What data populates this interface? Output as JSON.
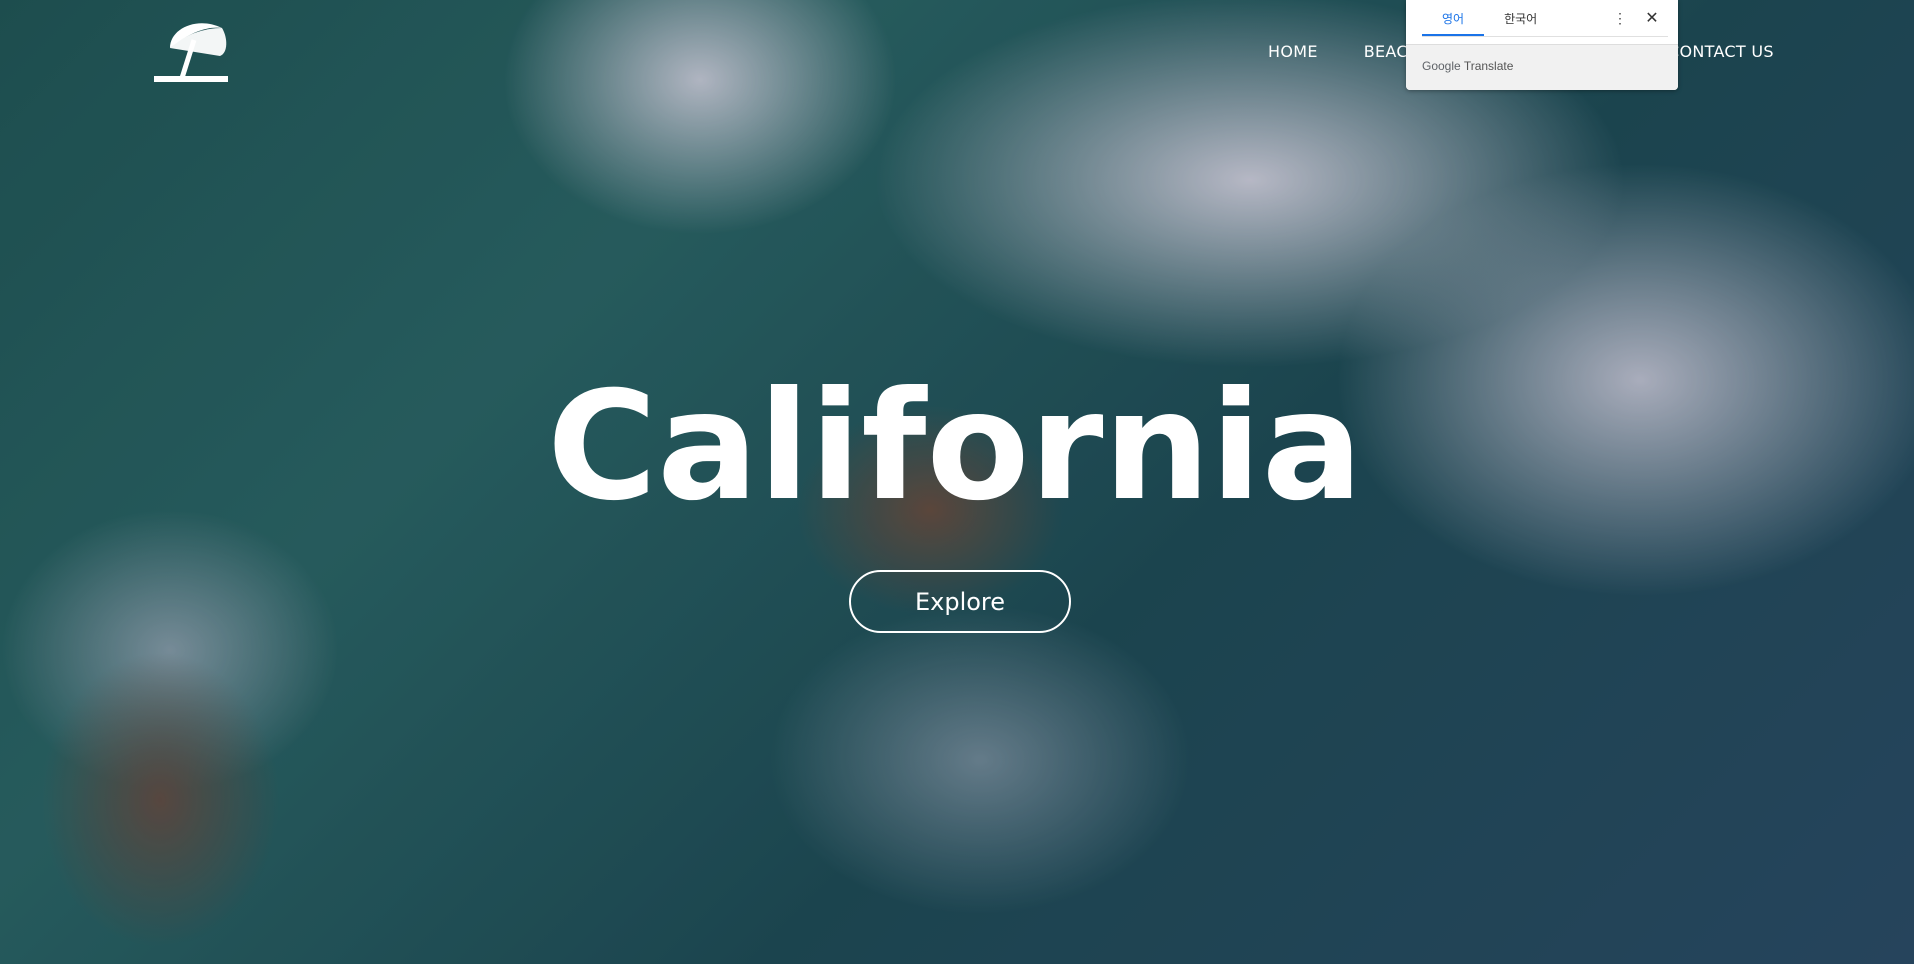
{
  "nav": {
    "items": [
      {
        "label": "HOME"
      },
      {
        "label": "BEACH"
      },
      {
        "label": "CONTACT US"
      }
    ]
  },
  "hero": {
    "title": "California",
    "cta_label": "Explore"
  },
  "translate_popup": {
    "tabs": [
      {
        "label": "영어",
        "active": true
      },
      {
        "label": "한국어",
        "active": false
      }
    ],
    "more_icon": "more-vert-icon",
    "close_icon": "close-icon",
    "brand_google": "Google",
    "brand_translate": "Translate",
    "accent_color": "#1a73e8"
  }
}
